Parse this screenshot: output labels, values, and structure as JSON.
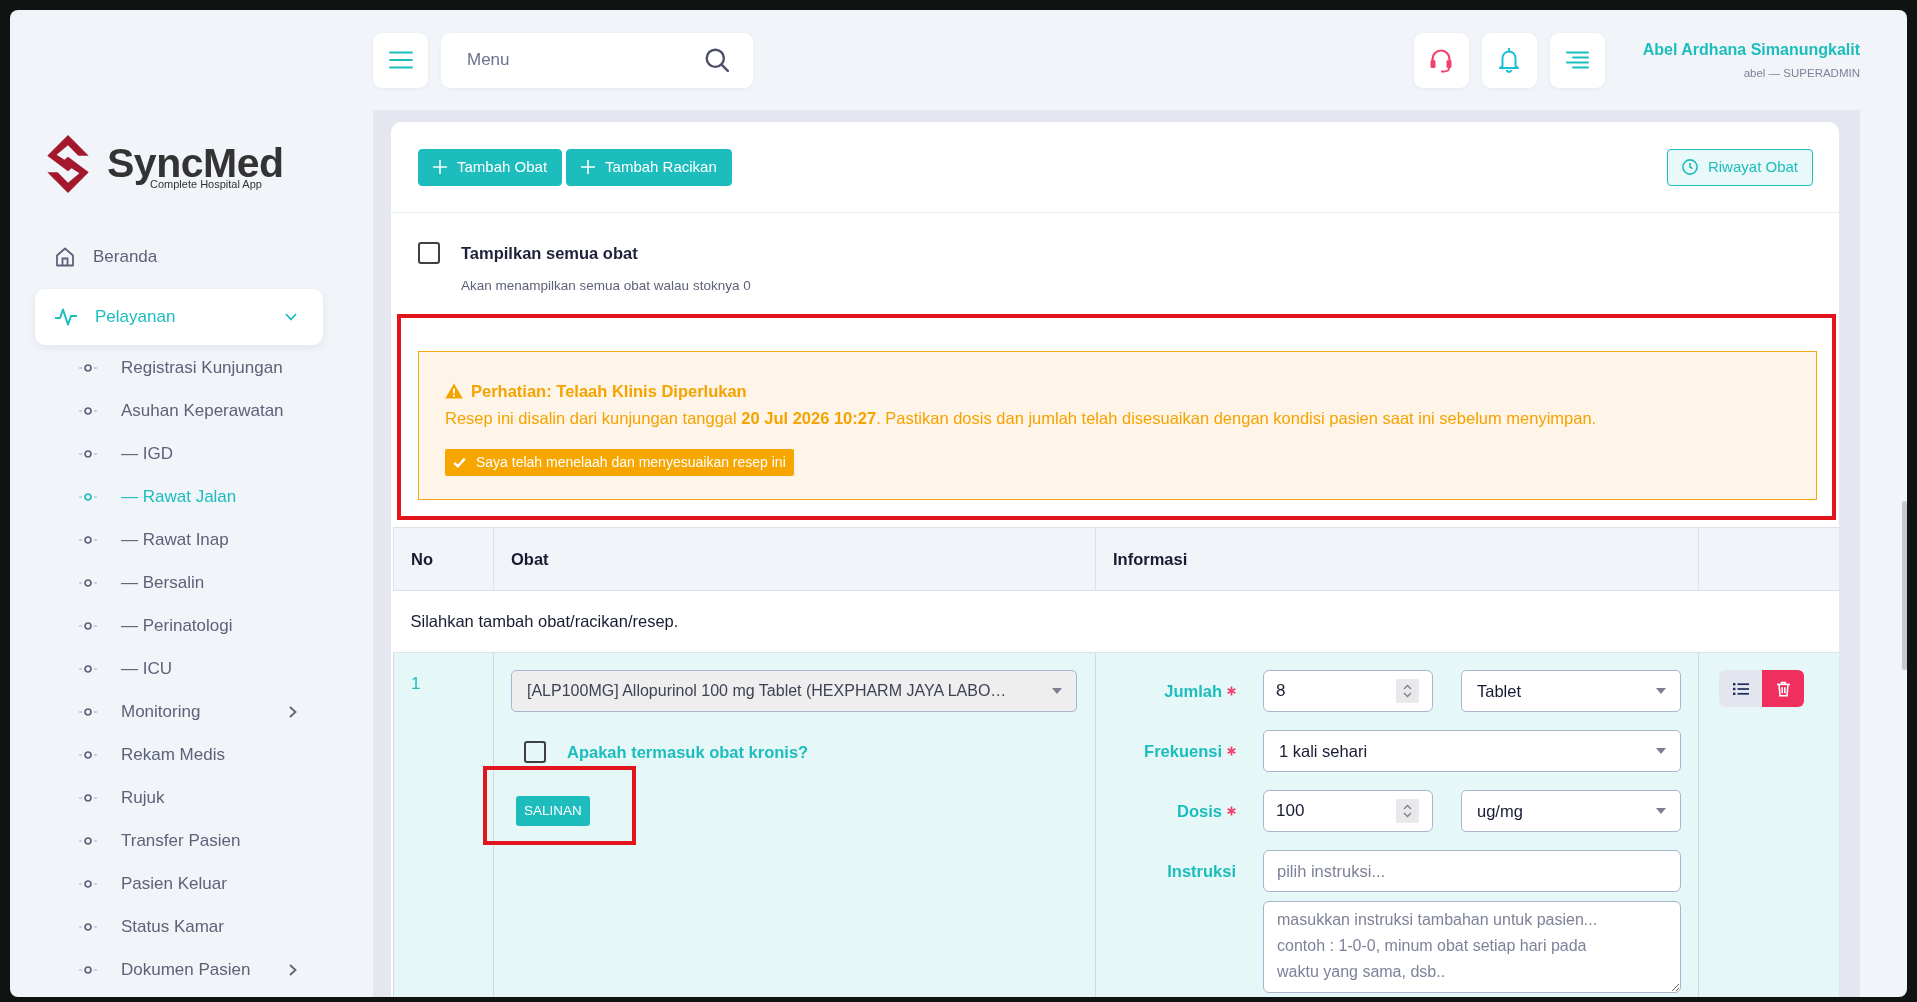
{
  "header": {
    "search": {
      "placeholder": "Menu"
    },
    "user": {
      "name": "Abel Ardhana Simanungkalit",
      "role": "abel — SUPERADMIN"
    }
  },
  "sidebar": {
    "logo": {
      "name": "SyncMed",
      "tagline": "Complete Hospital App"
    },
    "items": [
      {
        "label": "Beranda",
        "kind": "link",
        "selected": false
      },
      {
        "label": "Pelayanan",
        "kind": "group",
        "selected": true,
        "expanded": true,
        "children": [
          {
            "label": "Registrasi Kunjungan",
            "kind": "link",
            "selected": false
          },
          {
            "label": "Asuhan Keperawatan",
            "kind": "link",
            "selected": false
          },
          {
            "label": "— IGD",
            "kind": "link",
            "selected": false
          },
          {
            "label": "— Rawat Jalan",
            "kind": "link",
            "selected": true
          },
          {
            "label": "— Rawat Inap",
            "kind": "link",
            "selected": false
          },
          {
            "label": "— Bersalin",
            "kind": "link",
            "selected": false
          },
          {
            "label": "— Perinatologi",
            "kind": "link",
            "selected": false
          },
          {
            "label": "— ICU",
            "kind": "link",
            "selected": false
          },
          {
            "label": "Monitoring",
            "kind": "group",
            "selected": false,
            "expanded": false
          },
          {
            "label": "Rekam Medis",
            "kind": "link",
            "selected": false
          },
          {
            "label": "Rujuk",
            "kind": "link",
            "selected": false
          },
          {
            "label": "Transfer Pasien",
            "kind": "link",
            "selected": false
          },
          {
            "label": "Pasien Keluar",
            "kind": "link",
            "selected": false
          },
          {
            "label": "Status Kamar",
            "kind": "link",
            "selected": false
          },
          {
            "label": "Dokumen Pasien",
            "kind": "group",
            "selected": false,
            "expanded": false
          }
        ]
      }
    ]
  },
  "toolbar": [
    {
      "label": "Tambah Obat",
      "kind": "add"
    },
    {
      "label": "Tambah Racikan",
      "kind": "add"
    },
    {
      "label": "Riwayat Obat",
      "kind": "history"
    }
  ],
  "show_all": {
    "label": "Tampilkan semua obat",
    "hint": "Akan menampilkan semua obat walau stoknya 0",
    "checked": false
  },
  "alert": {
    "highlighted": true,
    "title": "Perhatian: Telaah Klinis Diperlukan",
    "message": "Resep ini disalin dari kunjungan tanggal **20 Jul 2026 10:27**. Pastikan dosis dan jumlah telah disesuaikan dengan kondisi pasien saat ini sebelum menyimpan.",
    "confirm": {
      "label": "Saya telah menelaah dan menyesuaikan resep ini"
    }
  },
  "table": {
    "columns": [
      "No",
      "Obat",
      "Informasi"
    ],
    "empty_message": "Silahkan tambah obat/racikan/resep.",
    "rows": [
      {
        "no": "1",
        "drug": {
          "value": "[ALP100MG] Allopurinol 100 mg Tablet (HEXPHARM JAYA LABO…",
          "disabled": true
        },
        "chronic": {
          "label": "Apakah termasuk obat kronis?",
          "checked": false
        },
        "copy_badge": {
          "label": "SALINAN",
          "highlighted": true
        },
        "fields": [
          {
            "kind": "number",
            "label": "Jumlah",
            "required": true,
            "value": "8",
            "unit": "Tablet"
          },
          {
            "kind": "select",
            "label": "Frekuensi",
            "required": true,
            "value": "1 kali sehari"
          },
          {
            "kind": "number",
            "label": "Dosis",
            "required": true,
            "value": "100",
            "unit": "ug/mg"
          },
          {
            "kind": "instructions",
            "label": "Instruksi",
            "required": false,
            "placeholder": "pilih instruksi...",
            "note_placeholder": "masukkan instruksi tambahan untuk pasien...\ncontoh : 1-0-0, minum obat setiap hari pada\nwaktu yang sama, dsb.."
          }
        ]
      }
    ]
  }
}
